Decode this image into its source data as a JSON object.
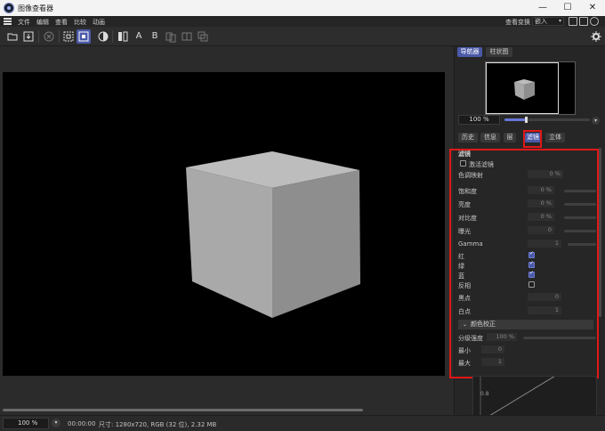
{
  "window": {
    "title": "图像查看器",
    "buttons": {
      "minimize": "—",
      "maximize": "☐",
      "close": "✕"
    }
  },
  "menu": {
    "items": [
      "文件",
      "编辑",
      "查看",
      "比较",
      "动画"
    ],
    "view_transform_label": "查看变换",
    "view_transform_value": "嵌入"
  },
  "toolbar": {
    "text_buttons": {
      "a": "A",
      "b": "B"
    }
  },
  "viewport": {
    "cube_colors": {
      "top": "#bdbdbd",
      "left": "#a9a9a9",
      "right": "#8e8e8e"
    }
  },
  "status": {
    "zoom": "100 %",
    "timecode": "00:00:00",
    "size_info": "尺寸: 1280x720, RGB (32 位), 2.32 MB"
  },
  "panel": {
    "top_tabs": [
      "导航器",
      "柱状图"
    ],
    "nav_zoom": "100 %",
    "mid_tabs": [
      "历史",
      "信息",
      "层",
      "滤镜",
      "立体"
    ],
    "filter": {
      "header": "滤镜",
      "activate_label": "激活滤镜",
      "tonemap_label": "色调映射",
      "tonemap_value": "0 %",
      "saturation_label": "饱和度",
      "saturation_value": "0 %",
      "brightness_label": "亮度",
      "brightness_value": "0 %",
      "contrast_label": "对比度",
      "contrast_value": "0 %",
      "exposure_label": "曝光",
      "exposure_value": "0",
      "gamma_label": "Gamma",
      "gamma_value": "1",
      "red_label": "红",
      "green_label": "绿",
      "blue_label": "蓝",
      "invert_label": "反相",
      "black_label": "黑点",
      "black_value": "0",
      "white_label": "白点",
      "white_value": "1",
      "color_correction_label": "颜色校正",
      "gradation_label": "分级强度",
      "gradation_value": "100 %",
      "min_label": "最小",
      "min_value": "0",
      "max_label": "最大",
      "max_value": "1",
      "curve_tick": "0.8"
    },
    "accent": "#4a5aa8",
    "highlight": "#e01717"
  }
}
